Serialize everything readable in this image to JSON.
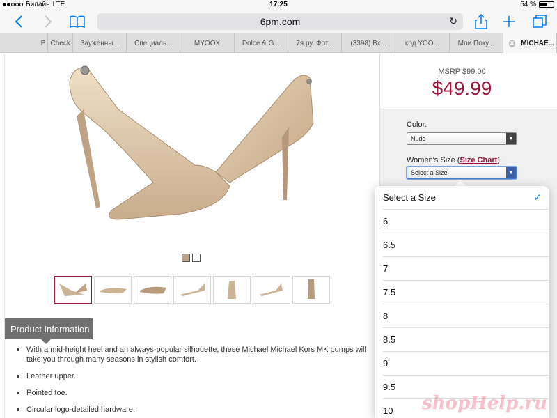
{
  "status_bar": {
    "carrier": "Билайн",
    "network": "LTE",
    "time": "17:25",
    "battery_text": "54 %",
    "battery_level": 0.54
  },
  "browser": {
    "url": "6pm.com",
    "icons": {
      "back": "back-icon",
      "forward": "forward-icon",
      "bookmarks": "bookmarks-icon",
      "reload": "reload-icon",
      "share": "share-icon",
      "new_tab": "plus-icon",
      "tabs": "tabs-icon"
    },
    "tabs": [
      {
        "label": "Р"
      },
      {
        "label": "Check"
      },
      {
        "label": "Зауженны..."
      },
      {
        "label": "Специаль..."
      },
      {
        "label": "MYOOX"
      },
      {
        "label": "Dolce & G..."
      },
      {
        "label": "7я.ру. Фот..."
      },
      {
        "label": "(3398) Вх..."
      },
      {
        "label": "код YOO..."
      },
      {
        "label": "Мои Поку..."
      },
      {
        "label": "MICHAE..."
      }
    ]
  },
  "product": {
    "msrp": "MSRP $99.00",
    "price": "$49.99",
    "color_label": "Color:",
    "color_value": "Nude",
    "size_label_prefix": "Women's Size (",
    "size_chart_link": "Size Chart",
    "size_label_suffix": "):",
    "size_value": "Select a Size",
    "info_tab": "Product Information",
    "bullets": [
      "With a mid-height heel and an always-popular silhouette, these Michael Michael Kors MK pumps will take you through many seasons in stylish comfort.",
      "Leather upper.",
      "Pointed toe.",
      "Circular logo-detailed hardware."
    ],
    "colors": {
      "price": "#a0143c",
      "shoe": "#d8c0a2"
    }
  },
  "size_dropdown": {
    "selected": "Select a Size",
    "options": [
      "Select a Size",
      "6",
      "6.5",
      "7",
      "7.5",
      "8",
      "8.5",
      "9",
      "9.5",
      "10"
    ]
  },
  "watermark": "shopHelp.ru"
}
